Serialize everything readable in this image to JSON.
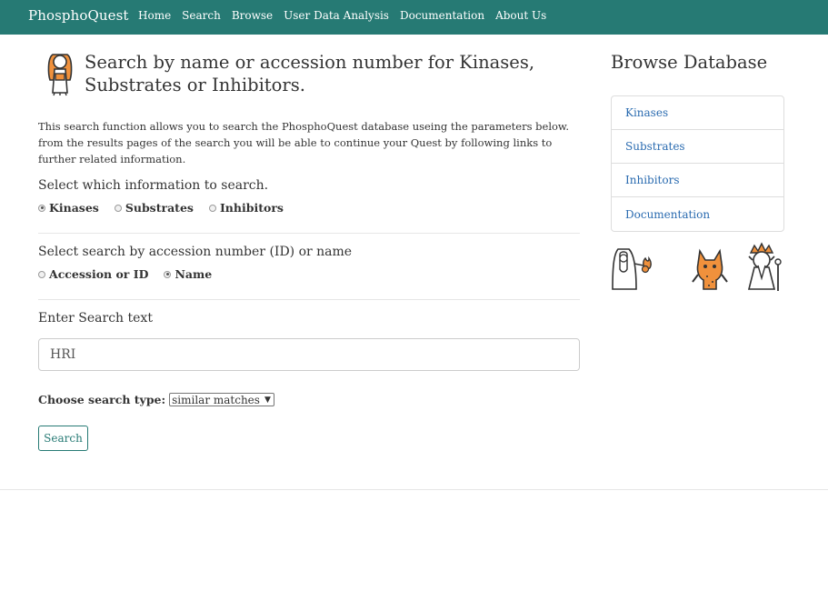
{
  "nav": {
    "brand": "PhosphoQuest",
    "links": [
      "Home",
      "Search",
      "Browse",
      "User Data Analysis",
      "Documentation",
      "About Us"
    ]
  },
  "main": {
    "title": "Search by name or accession number for Kinases, Substrates or Inhibitors.",
    "intro": "This search function allows you to search the PhosphoQuest database useing the parameters below. from the results pages of the search you will be able to continue your Quest by following links to further related information.",
    "info_label": "Select which information to search.",
    "info_options": [
      "Kinases",
      "Substrates",
      "Inhibitors"
    ],
    "info_selected": "Kinases",
    "by_label": "Select search by accession number (ID) or name",
    "by_options": [
      "Accession or ID",
      "Name"
    ],
    "by_selected": "Name",
    "text_label": "Enter Search text",
    "search_value": "HRI",
    "type_label": "Choose search type:",
    "type_value": "similar matches",
    "search_button": "Search"
  },
  "sidebar": {
    "title": "Browse Database",
    "items": [
      "Kinases",
      "Substrates",
      "Inhibitors",
      "Documentation"
    ]
  },
  "colors": {
    "navbar": "#267a74",
    "link": "#2a6bb0",
    "icon_orange": "#f0913c"
  }
}
